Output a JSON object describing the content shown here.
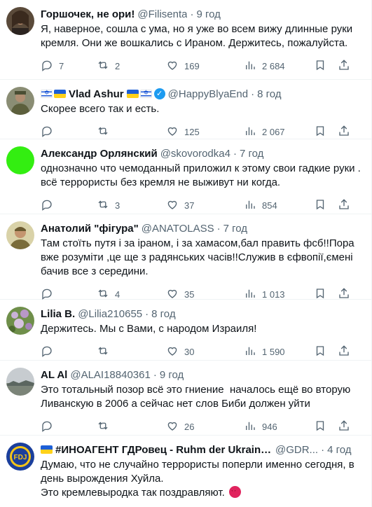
{
  "tweets": [
    {
      "name": "Горшочек, не ори!",
      "handle": "@Filisenta",
      "time": "9 год",
      "text": "Я, наверное, сошла с ума, но я уже во всем вижу длинные руки кремля. Они же вошкались с Ираном. Держитесь, пожалуйста.",
      "replies": "7",
      "retweets": "2",
      "likes": "169",
      "views": "2 684",
      "avatar": "avatar-photo-woman"
    },
    {
      "name": "Vlad Ashur",
      "handle": "@HappyBlyaEnd",
      "time": "8 год",
      "text": "Скорее всего так и есть.",
      "replies": "",
      "retweets": "",
      "likes": "125",
      "views": "2 067",
      "avatar": "avatar-photo-soldier"
    },
    {
      "name": "Александр Орлянский",
      "handle": "@skovorodka4",
      "time": "7 год",
      "text": "однозначно что чемоданный приложил к этому свои гадкие руки . всё террористы без кремля не выживут ни когда.",
      "replies": "",
      "retweets": "3",
      "likes": "37",
      "views": "854",
      "avatar": "avatar-green-circle"
    },
    {
      "name": "Анатолий \"фігура\"",
      "handle": "@ANATOLASS",
      "time": "7 год",
      "text": "Там стоїть путя і за іраном, і за хамасом,бал править фсб!!Пора вже розуміти ,це ще з радянських часів!!Служив в єфвопії,ємені бачив все з середини.",
      "replies": "",
      "retweets": "4",
      "likes": "35",
      "views": "1 013",
      "avatar": "avatar-photo-man"
    },
    {
      "name": "Lilia B.",
      "handle": "@Lilia210655",
      "time": "8 год",
      "text": "Держитесь. Мы с Вами, с народом Израиля!",
      "replies": "",
      "retweets": "",
      "likes": "30",
      "views": "1 590",
      "avatar": "avatar-photo-flowers"
    },
    {
      "name": "AL Al",
      "handle": "@ALAI18840361",
      "time": "9 год",
      "text": "Это тотальный позор всё это гниение  началось ещё во вторую Ливанскую в 2006 а сейчас нет слов Биби должен уйти",
      "replies": "",
      "retweets": "",
      "likes": "26",
      "views": "946",
      "avatar": "avatar-photo-landscape"
    },
    {
      "name": "#ИНОАГЕНТ ГДРовец - Ruhm der Ukraine!...",
      "handle": "@GDR...",
      "time": "4 год",
      "text": "Думаю, что не случайно террористы поперли именно сегодня, в день вырождения Хуйла.\nЭто кремлевыродка так поздравляют.",
      "replies": "",
      "retweets": "",
      "likes": "",
      "views": "",
      "avatar": "avatar-fdj-emblem"
    }
  ],
  "icons": {
    "reply": "reply-icon",
    "retweet": "retweet-icon",
    "like": "heart-icon",
    "views": "views-icon",
    "bookmark": "bookmark-icon",
    "share": "share-icon"
  },
  "colors": {
    "text": "#0f1419",
    "secondary": "#536471",
    "verified": "#1d9bf0",
    "divider": "#eff3f4"
  }
}
